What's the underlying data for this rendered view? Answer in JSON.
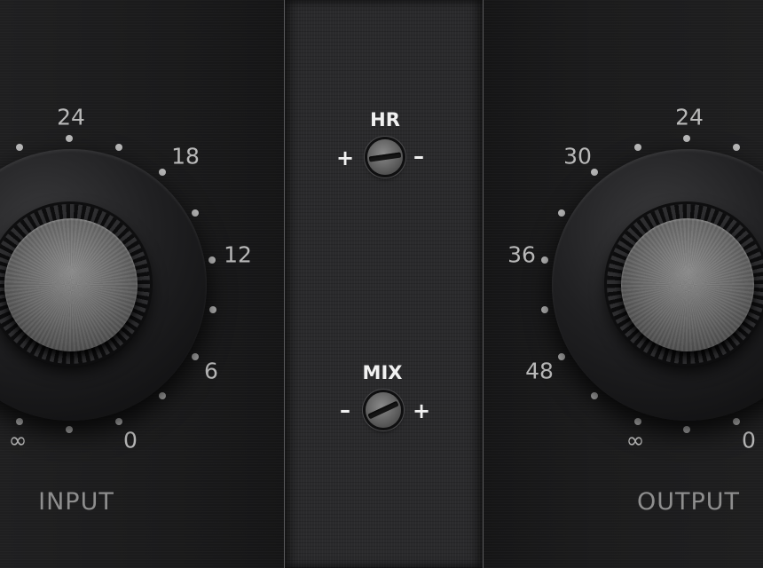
{
  "input": {
    "label": "INPUT",
    "scale": [
      "24",
      "18",
      "12",
      "6",
      "0",
      "∞"
    ]
  },
  "output": {
    "label": "OUTPUT",
    "scale": [
      "24",
      "30",
      "36",
      "48",
      "∞",
      "0"
    ]
  },
  "hr": {
    "label": "HR",
    "left_sign": "+",
    "right_sign": "–"
  },
  "mix": {
    "label": "MIX",
    "left_sign": "–",
    "right_sign": "+"
  }
}
